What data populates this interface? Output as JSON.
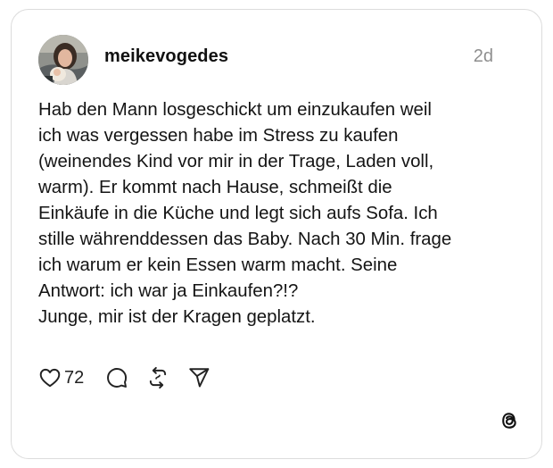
{
  "post": {
    "username": "meikevogedes",
    "timestamp": "2d",
    "text_lines": [
      "Hab den Mann losgeschickt um einzukaufen weil",
      "ich was vergessen habe im Stress zu kaufen",
      "(weinendes Kind vor mir in der Trage, Laden voll,",
      "warm). Er kommt nach Hause, schmeißt die",
      "Einkäufe in die Küche und legt sich aufs Sofa. Ich",
      "stille währenddessen das Baby. Nach 30 Min. frage",
      "ich warum er kein Essen warm macht. Seine",
      "Antwort: ich war ja Einkaufen?!?",
      "Junge, mir ist der Kragen geplatzt."
    ],
    "like_count": "72"
  },
  "icons": {
    "like": "heart-icon",
    "reply": "comment-bubble-icon",
    "repost": "repost-icon",
    "share": "send-icon",
    "brand": "threads-logo-icon"
  },
  "colors": {
    "text": "#141414",
    "muted": "#8e8e8e",
    "border": "#dcdcdc",
    "background": "#ffffff"
  }
}
